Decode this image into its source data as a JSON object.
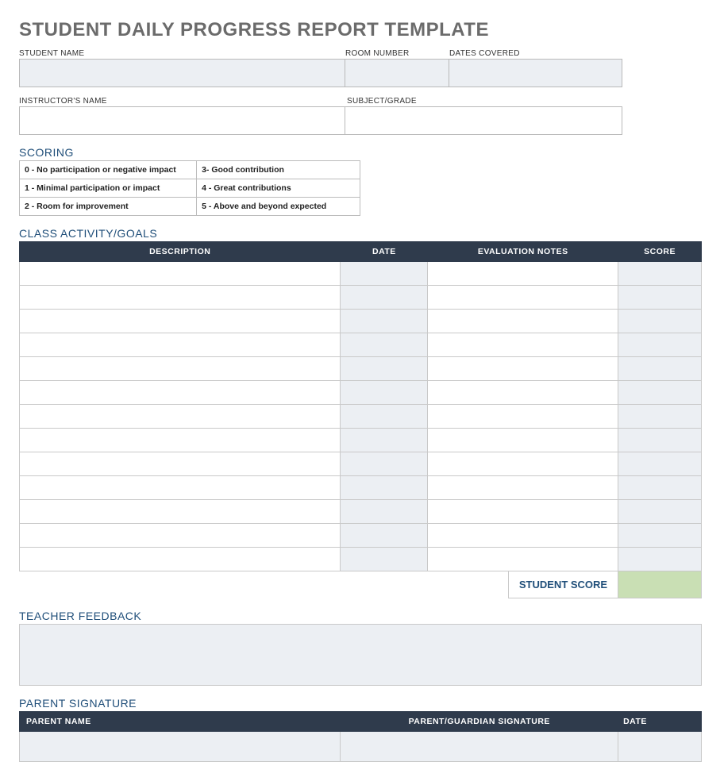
{
  "title": "STUDENT DAILY PROGRESS REPORT TEMPLATE",
  "fields": {
    "student_name": "STUDENT NAME",
    "room_number": "ROOM NUMBER",
    "dates_covered": "DATES COVERED",
    "instructor_name": "INSTRUCTOR'S NAME",
    "subject_grade": "SUBJECT/GRADE"
  },
  "scoring": {
    "heading": "SCORING",
    "rows": [
      {
        "left": "0 - No participation or negative impact",
        "right": "3- Good contribution"
      },
      {
        "left": "1 - Minimal participation or impact",
        "right": "4 - Great contributions"
      },
      {
        "left": "2 - Room for improvement",
        "right": "5 - Above and beyond expected"
      }
    ]
  },
  "goals": {
    "heading": "CLASS ACTIVITY/GOALS",
    "headers": {
      "description": "DESCRIPTION",
      "date": "DATE",
      "notes": "EVALUATION NOTES",
      "score": "SCORE"
    },
    "row_count": 13
  },
  "student_score_label": "STUDENT SCORE",
  "feedback_heading": "TEACHER FEEDBACK",
  "parent": {
    "heading": "PARENT SIGNATURE",
    "headers": {
      "name": "PARENT NAME",
      "signature": "PARENT/GUARDIAN SIGNATURE",
      "date": "DATE"
    }
  }
}
